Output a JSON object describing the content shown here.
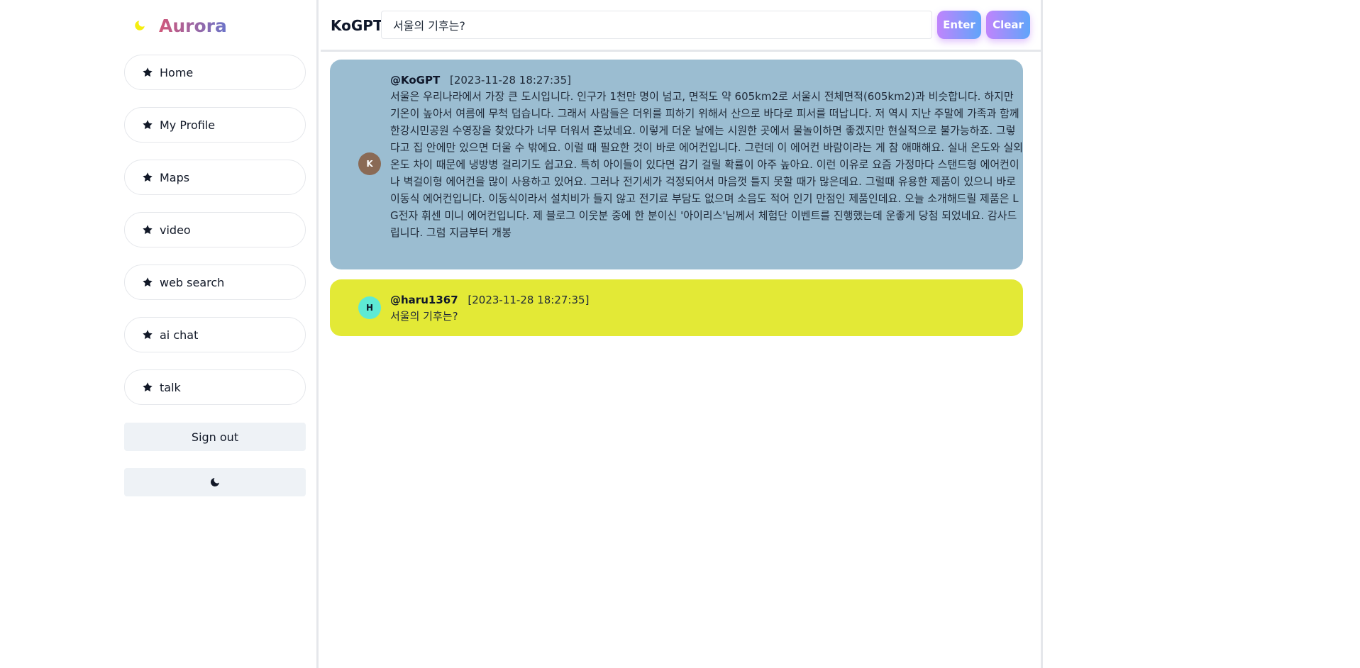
{
  "sidebar": {
    "brand": "Aurora",
    "nav": [
      {
        "label": "Home"
      },
      {
        "label": "My Profile"
      },
      {
        "label": "Maps"
      },
      {
        "label": "video"
      },
      {
        "label": "web search"
      },
      {
        "label": "ai chat"
      },
      {
        "label": "talk"
      }
    ],
    "sign_out": "Sign out"
  },
  "header": {
    "title": "KoGPT",
    "input_value": "서울의 기후는?",
    "enter_label": "Enter",
    "clear_label": "Clear"
  },
  "messages": [
    {
      "avatar": "K",
      "handle": "@KoGPT",
      "time": "[2023-11-28 18:27:35]",
      "text": "서울은 우리나라에서 가장 큰 도시입니다. 인구가 1천만 명이 넘고, 면적도 약 605km2로 서울시 전체면적(605km2)과 비슷합니다. 하지만 기온이 높아서 여름에 무척 덥습니다. 그래서 사람들은 더위를 피하기 위해서 산으로 바다로 피서를 떠납니다. 저 역시 지난 주말에 가족과 함께 한강시민공원 수영장을 찾았다가 너무 더워서 혼났네요. 이렇게 더운 날에는 시원한 곳에서 물놀이하면 좋겠지만 현실적으로 불가능하죠. 그렇다고 집 안에만 있으면 더울 수 밖에요. 이럴 때 필요한 것이 바로 에어컨입니다. 그런데 이 에어컨 바람이라는 게 참 애매해요. 실내 온도와 실외온도 차이 때문에 냉방병 걸리기도 쉽고요. 특히 아이들이 있다면 감기 걸릴 확률이 아주 높아요. 이런 이유로 요즘 가정마다 스탠드형 에어컨이나 벽걸이형 에어컨을 많이 사용하고 있어요. 그러나 전기세가 걱정되어서 마음껏 틀지 못할 때가 많은데요. 그럴때 유용한 제품이 있으니 바로 이동식 에어컨입니다. 이동식이라서 설치비가 들지 않고 전기료 부담도 없으며 소음도 적어 인기 만점인 제품인데요. 오늘 소개해드릴 제품은 LG전자 휘센 미니 에어컨입니다. 제 블로그 이웃분 중에 한 분이신 '아이리스'님께서 체험단 이벤트를 진행했는데 운좋게 당첨 되었네요. 감사드립니다. 그럼 지금부터 개봉"
    },
    {
      "avatar": "H",
      "handle": "@haru1367",
      "time": "[2023-11-28 18:27:35]",
      "text": "서울의 기후는?"
    }
  ],
  "colors": {
    "ai_bubble": "#9bbdd1",
    "user_bubble": "#e3e936",
    "brand_gradient_start": "#d1577a",
    "brand_gradient_end": "#6b74c9",
    "button_gradient_start": "#c084fc",
    "button_gradient_end": "#60a5fa"
  },
  "icons": {
    "brand": "moon-icon",
    "nav": "star-icon",
    "theme_toggle": "moon-icon"
  }
}
